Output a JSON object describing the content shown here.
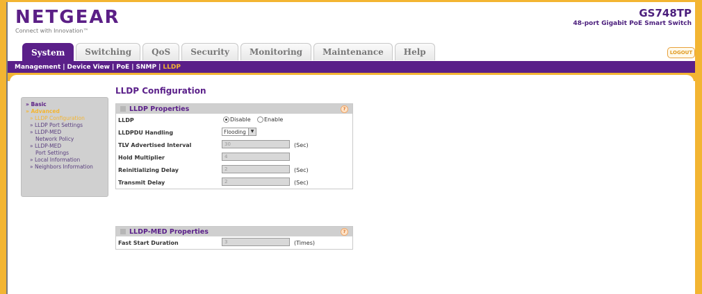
{
  "brand": {
    "logo": "NETGEAR",
    "tagline": "Connect with Innovation™",
    "model": "GS748TP",
    "model_desc": "48-port Gigabit PoE Smart Switch"
  },
  "tabs": [
    {
      "label": "System",
      "active": true
    },
    {
      "label": "Switching",
      "active": false
    },
    {
      "label": "QoS",
      "active": false
    },
    {
      "label": "Security",
      "active": false
    },
    {
      "label": "Monitoring",
      "active": false
    },
    {
      "label": "Maintenance",
      "active": false
    },
    {
      "label": "Help",
      "active": false
    }
  ],
  "logout_label": "LOGOUT",
  "subnav": [
    {
      "label": "Management"
    },
    {
      "label": "Device View"
    },
    {
      "label": "PoE"
    },
    {
      "label": "SNMP"
    },
    {
      "label": "LLDP",
      "selected": true
    }
  ],
  "sidebar": {
    "basic": "» Basic",
    "advanced": "» Advanced",
    "items": [
      {
        "label": "» LLDP Configuration",
        "selected": true
      },
      {
        "label": "» LLDP Port Settings"
      },
      {
        "label": "» LLDP-MED",
        "label2": "Network Policy"
      },
      {
        "label": "» LLDP-MED",
        "label2": "Port Settings"
      },
      {
        "label": "» Local Information"
      },
      {
        "label": "» Neighbors Information"
      }
    ]
  },
  "page_title": "LLDP Configuration",
  "lldp_properties": {
    "title": "LLDP Properties",
    "help_icon": "?",
    "lldp_label": "LLDP",
    "radio_disable": "Disable",
    "radio_enable": "Enable",
    "lldp_state": "Disable",
    "pdu_label": "LLDPDU Handling",
    "pdu_value": "Flooding",
    "tlv_label": "TLV Advertised Interval",
    "tlv_value": "30",
    "hold_label": "Hold Multiplier",
    "hold_value": "4",
    "reinit_label": "Reinitializing Delay",
    "reinit_value": "2",
    "transmit_label": "Transmit Delay",
    "transmit_value": "2",
    "sec_unit": "(Sec)"
  },
  "lldp_med_properties": {
    "title": "LLDP-MED Properties",
    "help_icon": "?",
    "fast_start_label": "Fast Start Duration",
    "fast_start_value": "3",
    "times_unit": "(Times)"
  },
  "colors": {
    "brand_purple": "#5a1f89",
    "accent_orange": "#f3b532"
  }
}
